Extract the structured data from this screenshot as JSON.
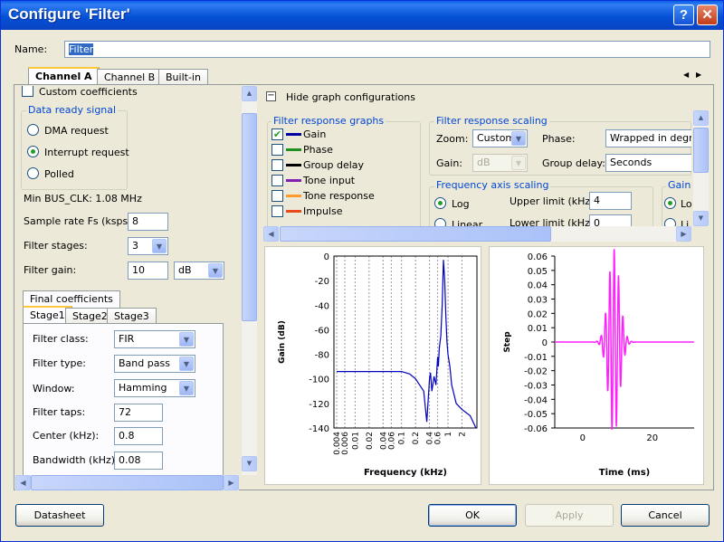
{
  "window": {
    "title": "Configure 'Filter'",
    "help_glyph": "?",
    "close_glyph": "✕"
  },
  "name": {
    "label": "Name:",
    "value": "Filter"
  },
  "main_tabs": [
    "Channel A",
    "Channel B",
    "Built-in"
  ],
  "left": {
    "custom_coefficients": "Custom coefficients",
    "data_ready": {
      "title": "Data ready signal",
      "options": [
        "DMA request",
        "Interrupt request",
        "Polled"
      ],
      "selected": 1
    },
    "min_bus_clk": "Min BUS_CLK: 1.08 MHz",
    "sample_rate": {
      "label": "Sample rate Fs (ksps):",
      "value": "8"
    },
    "filter_stages": {
      "label": "Filter stages:",
      "value": "3"
    },
    "filter_gain": {
      "label": "Filter gain:",
      "value": "10",
      "unit": "dB"
    },
    "final_coefficients": "Final coefficients",
    "stage_tabs": [
      "Stage1",
      "Stage2",
      "Stage3"
    ],
    "filter_class": {
      "label": "Filter class:",
      "value": "FIR"
    },
    "filter_type": {
      "label": "Filter type:",
      "value": "Band pass"
    },
    "window": {
      "label": "Window:",
      "value": "Hamming"
    },
    "filter_taps": {
      "label": "Filter taps:",
      "value": "72"
    },
    "center": {
      "label": "Center (kHz):",
      "value": "0.8"
    },
    "bandwidth": {
      "label": "Bandwidth (kHz):",
      "value": "0.08"
    }
  },
  "right": {
    "hide_graph": "Hide graph configurations",
    "response_graphs": {
      "title": "Filter response graphs",
      "items": [
        {
          "label": "Gain",
          "color": "#0000a0",
          "checked": true
        },
        {
          "label": "Phase",
          "color": "#1f8f1f",
          "checked": false
        },
        {
          "label": "Group delay",
          "color": "#000000",
          "checked": false
        },
        {
          "label": "Tone input",
          "color": "#8020b0",
          "checked": false
        },
        {
          "label": "Tone response",
          "color": "#ff9a2e",
          "checked": false
        },
        {
          "label": "Impulse",
          "color": "#e84a1a",
          "checked": false
        }
      ]
    },
    "response_scaling": {
      "title": "Filter response scaling",
      "zoom_label": "Zoom:",
      "zoom_value": "Custom",
      "phase_label": "Phase:",
      "phase_value": "Wrapped in degree",
      "gain_label": "Gain:",
      "gain_value": "dB",
      "group_delay_label": "Group delay:",
      "group_delay_value": "Seconds"
    },
    "freq_axis": {
      "title": "Frequency axis scaling",
      "log": "Log",
      "linear": "Linear",
      "upper_label": "Upper limit (kHz):",
      "upper_value": "4",
      "lower_label": "Lower limit (kHz):",
      "lower_value": "0"
    },
    "gain_axis": {
      "title": "Gain a",
      "opt1": "Lo",
      "opt2": "Li"
    }
  },
  "chart_data": [
    {
      "type": "line",
      "title": "",
      "xlabel": "Frequency (kHz)",
      "ylabel": "Gain (dB)",
      "x_scale": "log",
      "ylim": [
        -140,
        0
      ],
      "y_ticks": [
        "0",
        "-20",
        "-40",
        "-60",
        "-80",
        "-100",
        "-120",
        "-140"
      ],
      "x_ticks": [
        "0.004",
        "0.006",
        "0.01",
        "0.02",
        "0.04",
        "0.06",
        "0.1",
        "0.2",
        "0.4",
        "0.6",
        "1",
        "2"
      ],
      "series": [
        {
          "color": "#0000c0",
          "x": [
            0.004,
            0.1,
            0.15,
            0.2,
            0.3,
            0.35,
            0.4,
            0.42,
            0.45,
            0.5,
            0.55,
            0.6,
            0.62,
            0.65,
            0.7,
            0.75,
            0.8,
            0.85,
            0.9,
            0.95,
            1.0,
            1.1,
            1.2,
            1.5,
            2,
            3,
            4
          ],
          "y": [
            -94,
            -94,
            -96,
            -100,
            -110,
            -135,
            -100,
            -95,
            -110,
            -98,
            -105,
            -82,
            -90,
            -75,
            -65,
            -40,
            -3,
            -20,
            -50,
            -70,
            -80,
            -90,
            -105,
            -120,
            -125,
            -130,
            -140
          ]
        }
      ]
    },
    {
      "type": "line",
      "title": "",
      "xlabel": "Time (ms)",
      "ylabel": "Step",
      "xlim": [
        -8,
        32
      ],
      "ylim": [
        -0.06,
        0.06
      ],
      "y_ticks": [
        "0.06",
        "0.05",
        "0.04",
        "0.03",
        "0.02",
        "0.01",
        "0",
        "-0.01",
        "-0.02",
        "-0.03",
        "-0.04",
        "-0.05",
        "-0.06"
      ],
      "x_ticks": [
        "0",
        "20"
      ],
      "series": [
        {
          "color": "#ff20ff",
          "type": "step",
          "amplitude_peak": 0.065,
          "center_ms": 9,
          "period_ms": 1.25,
          "width_ms": 9
        }
      ]
    }
  ],
  "buttons": {
    "datasheet": "Datasheet",
    "ok": "OK",
    "apply": "Apply",
    "cancel": "Cancel"
  },
  "nav": {
    "left": "◀",
    "right": "▶"
  }
}
